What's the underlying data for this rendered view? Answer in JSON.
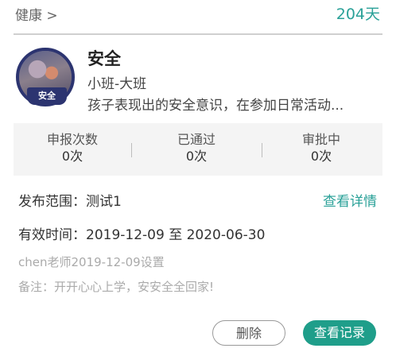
{
  "header": {
    "breadcrumb": "健康 >",
    "days": "204天"
  },
  "badge": {
    "ribbon_text": "安全"
  },
  "item": {
    "title": "安全",
    "grade": "小班-大班",
    "description": "孩子表现出的安全意识，在参加日常活动..."
  },
  "stats": [
    {
      "label": "申报次数",
      "value": "0次"
    },
    {
      "label": "已通过",
      "value": "0次"
    },
    {
      "label": "审批中",
      "value": "0次"
    }
  ],
  "scope": {
    "text": "发布范围：测试1",
    "link": "查看详情"
  },
  "validity": {
    "text": "有效时间：2019-12-09 至 2020-06-30"
  },
  "setter": "chen老师2019-12-09设置",
  "note": "备注：开开心心上学，安安全全回家!",
  "buttons": {
    "delete": "删除",
    "records": "查看记录"
  },
  "colors": {
    "accent": "#2aa198",
    "primary_button": "#1f9e8a",
    "badge_navy": "#2c3470"
  }
}
